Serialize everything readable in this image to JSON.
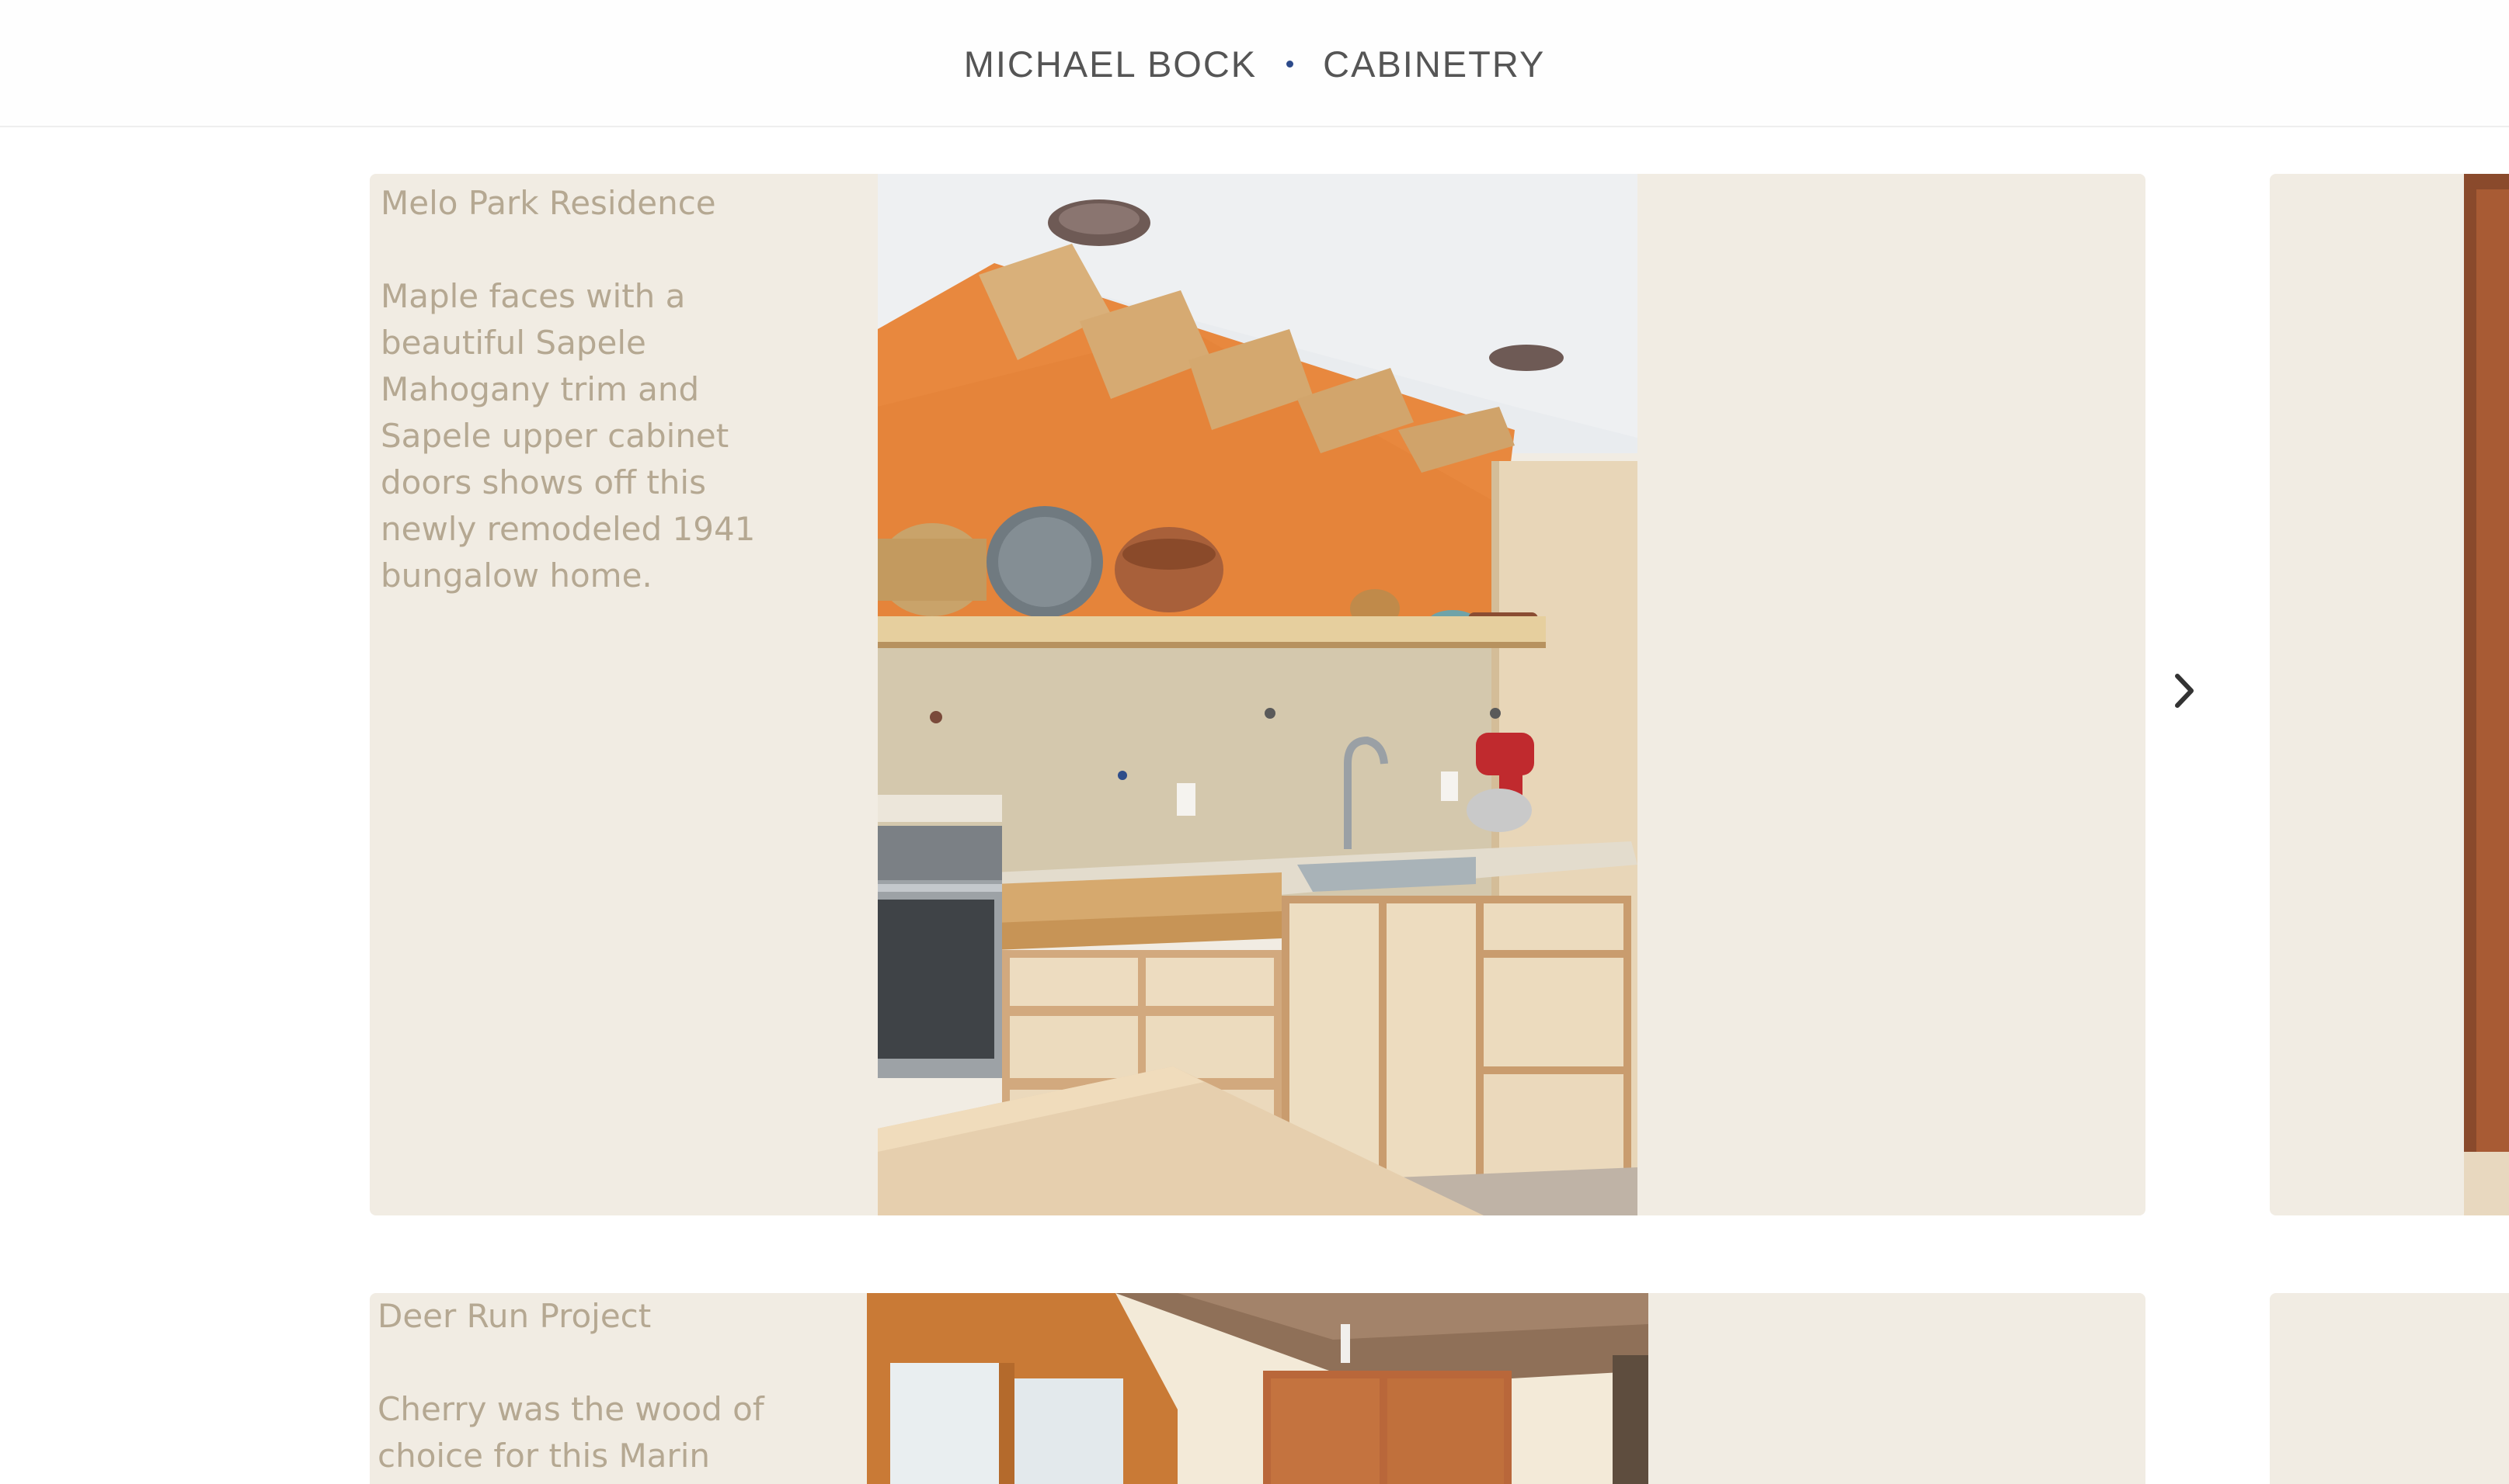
{
  "header": {
    "brand_left": "MICHAEL BOCK",
    "brand_right": "CABINETRY"
  },
  "projects": [
    {
      "title": "Melo Park Residence",
      "description": "Maple faces with a beautiful Sapele Mahogany trim and Sapele upper cabinet doors shows off this newly remodeled 1941 bungalow home."
    },
    {
      "title": "Deer Run Project",
      "description": "Cherry was the wood of choice for this Marin"
    }
  ],
  "icons": {
    "next": "chevron-right-icon"
  },
  "colors": {
    "panel_bg": "#f1ece3",
    "caption_text": "#b5a892",
    "brand_text": "#555555",
    "brand_dot": "#2c4a8a"
  }
}
